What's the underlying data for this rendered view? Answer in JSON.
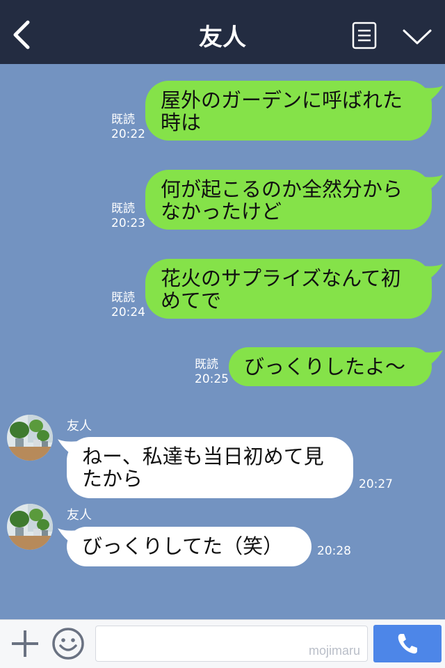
{
  "header": {
    "title": "友人",
    "back_icon": "chevron-left-icon",
    "menu_icon": "menu-list-icon",
    "collapse_icon": "chevron-down-icon"
  },
  "messages": [
    {
      "direction": "out",
      "text_line1": "屋外のガーデンに呼ばれた",
      "text_line2": "時は",
      "read": "既読",
      "time": "20:22"
    },
    {
      "direction": "out",
      "text_line1": "何が起こるのか全然分から",
      "text_line2": "なかったけど",
      "read": "既読",
      "time": "20:23"
    },
    {
      "direction": "out",
      "text_line1": "花火のサプライズなんて初",
      "text_line2": "めてで",
      "read": "既読",
      "time": "20:24"
    },
    {
      "direction": "out",
      "text_line1": "びっくりしたよ〜",
      "read": "既読",
      "time": "20:25"
    },
    {
      "direction": "in",
      "sender": "友人",
      "text_line1": "ねー、私達も当日初めて見",
      "text_line2": "たから",
      "time": "20:27"
    },
    {
      "direction": "in",
      "sender": "友人",
      "text_line1": "びっくりしてた（笑）",
      "time": "20:28"
    }
  ],
  "footer": {
    "plus_icon": "plus-icon",
    "emoji_icon": "smiley-icon",
    "input_value": "",
    "watermark": "mojimaru",
    "call_icon": "phone-icon"
  },
  "colors": {
    "header_bg": "#232c41",
    "chat_bg": "#7393c1",
    "outgoing_bubble": "#85e249",
    "incoming_bubble": "#ffffff",
    "call_button": "#4d86e8"
  }
}
